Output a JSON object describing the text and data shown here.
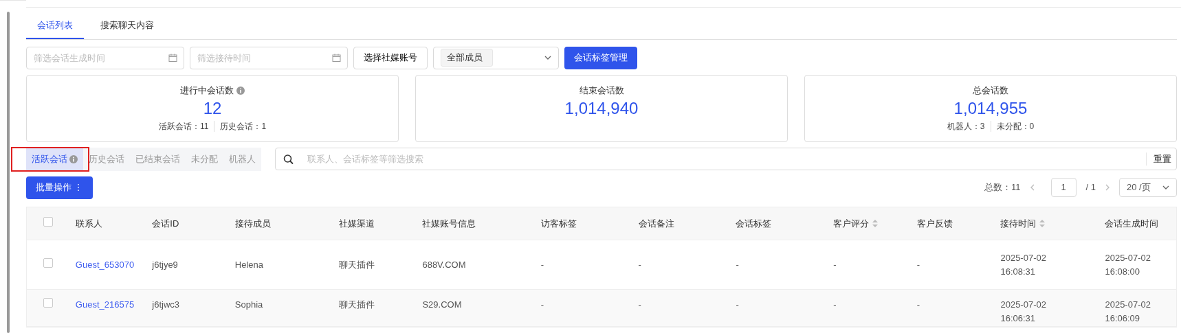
{
  "top_tabs": [
    {
      "label": "会话列表",
      "selected": true
    },
    {
      "label": "搜索聊天内容",
      "selected": false
    }
  ],
  "filters": {
    "created_time": {
      "placeholder": "筛选会话生成时间"
    },
    "reception_time": {
      "placeholder": "筛选接待时间"
    },
    "account_button": "选择社媒账号",
    "member_select": {
      "value": "全部成员"
    },
    "tag_button": "会话标签管理"
  },
  "stats": [
    {
      "title": "进行中会话数",
      "info": true,
      "value": "12",
      "details": [
        "活跃会话：11",
        "历史会话：1"
      ]
    },
    {
      "title": "结束会话数",
      "info": false,
      "value": "1,014,940"
    },
    {
      "title": "总会话数",
      "info": false,
      "value": "1,014,955",
      "details": [
        "机器人：3",
        "未分配：0"
      ]
    }
  ],
  "segments": [
    {
      "label": "活跃会话",
      "info": true,
      "selected": true
    },
    {
      "label": "历史会话",
      "info": false,
      "selected": false
    },
    {
      "label": "已结束会话",
      "info": false,
      "selected": false
    },
    {
      "label": "未分配",
      "info": false,
      "selected": false
    },
    {
      "label": "机器人",
      "info": false,
      "selected": false
    }
  ],
  "search": {
    "placeholder": "联系人、会话标签等筛选搜索",
    "reset": "重置"
  },
  "batch_button": "批量操作 ⋮",
  "pagination": {
    "total": "总数：11",
    "page": "1",
    "pages": "/  1",
    "page_size": "20 /页"
  },
  "table": {
    "header_checkbox": {
      "checked": false
    },
    "columns": [
      {
        "label": "联系人",
        "sortable": false
      },
      {
        "label": "会话ID",
        "sortable": false
      },
      {
        "label": "接待成员",
        "sortable": false
      },
      {
        "label": "社媒渠道",
        "sortable": false
      },
      {
        "label": "社媒账号信息",
        "sortable": false
      },
      {
        "label": "访客标签",
        "sortable": false
      },
      {
        "label": "会话备注",
        "sortable": false
      },
      {
        "label": "会话标签",
        "sortable": false
      },
      {
        "label": "客户评分",
        "sortable": true
      },
      {
        "label": "客户反馈",
        "sortable": false
      },
      {
        "label": "接待时间",
        "sortable": true
      },
      {
        "label": "会话生成时间",
        "sortable": false
      }
    ],
    "rows": [
      {
        "checked": false,
        "cells": [
          "Guest_653070",
          "j6tjye9",
          "Helena",
          "聊天插件",
          "688V.COM",
          "-",
          "-",
          "-",
          "-",
          "-",
          "2025-07-02 16:08:31",
          "2025-07-02 16:08:00"
        ]
      },
      {
        "checked": false,
        "cells": [
          "Guest_216575",
          "j6tjwc3",
          "Sophia",
          "聊天插件",
          "S29.COM",
          "-",
          "-",
          "-",
          "-",
          "-",
          "2025-07-02 16:06:31",
          "2025-07-02 16:06:09"
        ]
      }
    ]
  }
}
